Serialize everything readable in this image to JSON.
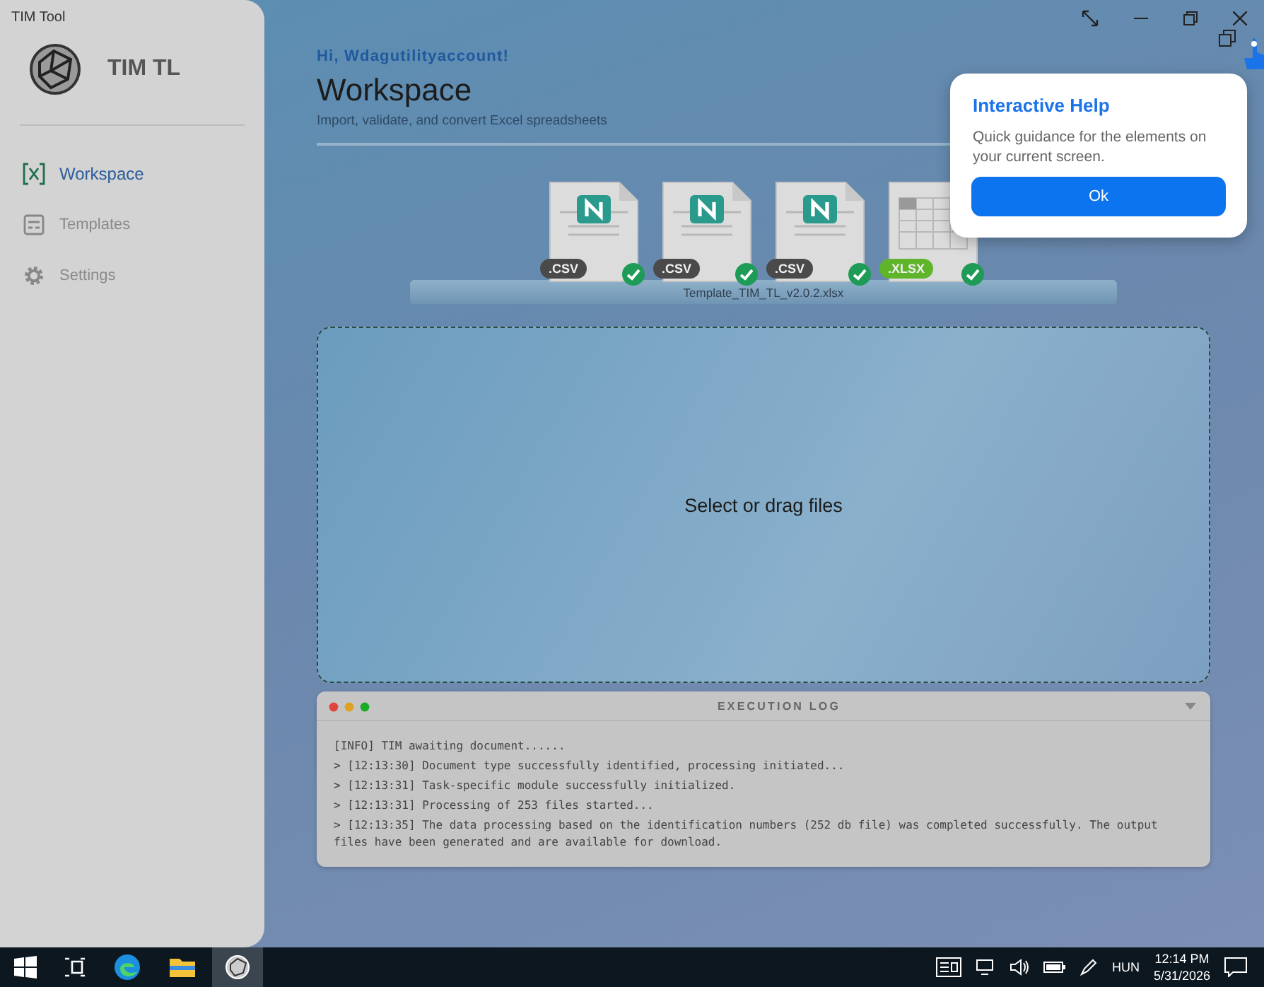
{
  "window": {
    "title": "TIM Tool"
  },
  "app": {
    "name": "TIM TL"
  },
  "sidebar": {
    "items": [
      {
        "label": "Workspace",
        "kind": "excel",
        "selected": true
      },
      {
        "label": "Templates",
        "kind": "template",
        "selected": false
      },
      {
        "label": "Settings",
        "kind": "gear",
        "selected": false
      }
    ]
  },
  "header": {
    "greeting": "Hi, Wdagutilityaccount!",
    "title": "Workspace",
    "subtitle": "Import, validate, and convert Excel spreadsheets"
  },
  "files": {
    "items": [
      {
        "kind": "csv",
        "badge": ".CSV",
        "done": true
      },
      {
        "kind": "csv",
        "badge": ".CSV",
        "done": true
      },
      {
        "kind": "csv",
        "badge": ".CSV",
        "done": true
      },
      {
        "kind": "xlsx",
        "badge": ".XLSX",
        "done": true
      }
    ],
    "template": "Template_TIM_TL_v2.0.2.xlsx"
  },
  "dropzone": {
    "label": "Select or drag files"
  },
  "log": {
    "title": "EXECUTION LOG",
    "lines": [
      "[INFO] TIM awaiting document......",
      "> [12:13:30] Document type successfully identified, processing initiated...",
      "> [12:13:31] Task-specific module successfully initialized.",
      "> [12:13:31] Processing of 253 files started...",
      "> [12:13:35] The data processing based on the identification numbers (252 db file) was completed successfully. The output files have been generated and are available for download."
    ]
  },
  "help_popup": {
    "title": "Interactive Help",
    "text": "Quick guidance for the elements on your current screen.",
    "button": "Ok"
  },
  "taskbar": {
    "language": "HUN",
    "time": "12:14 PM",
    "date": "5/31/2026"
  }
}
